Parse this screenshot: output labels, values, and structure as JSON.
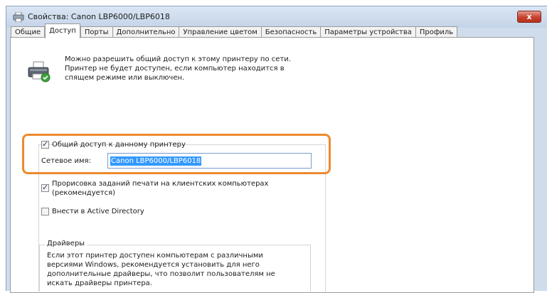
{
  "window": {
    "title": "Свойства: Canon LBP6000/LBP6018",
    "close_label": "x"
  },
  "tabs": [
    {
      "label": "Общие",
      "active": false
    },
    {
      "label": "Доступ",
      "active": true
    },
    {
      "label": "Порты",
      "active": false
    },
    {
      "label": "Дополнительно",
      "active": false
    },
    {
      "label": "Управление цветом",
      "active": false
    },
    {
      "label": "Безопасность",
      "active": false
    },
    {
      "label": "Параметры устройства",
      "active": false
    },
    {
      "label": "Профиль",
      "active": false
    }
  ],
  "sharing": {
    "description_lines": [
      "Можно разрешить общий доступ к этому принтеру по сети.",
      "Принтер не будет доступен, если компьютер находится в",
      "спящем режиме или выключен."
    ],
    "share_checkbox_label": "Общий доступ к данному принтеру",
    "share_checked": true,
    "network_name_label": "Сетевое имя:",
    "network_name_value": "Canon LBP6000/LBP6018",
    "render_jobs_label_line1": "Прорисовка заданий печати на клиентских компьютерах",
    "render_jobs_label_line2": "(рекомендуется)",
    "render_jobs_checked": true,
    "list_in_ad_label": "Внести в Active Directory",
    "list_in_ad_checked": false
  },
  "drivers": {
    "title": "Драйверы",
    "text_lines": [
      "Если этот принтер доступен компьютерам с различными",
      "версиями Windows, рекомендуется установить для него",
      "дополнительные драйверы, что позволит пользователям не",
      "искать драйверы принтера."
    ]
  },
  "colors": {
    "highlight": "#ee8a2e",
    "selection": "#3399ff",
    "close_button": "#c6432d"
  }
}
